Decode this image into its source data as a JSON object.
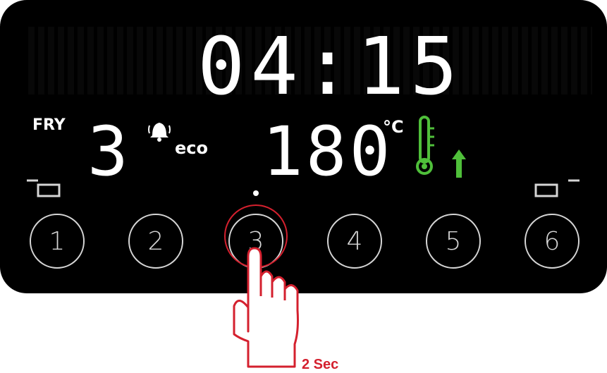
{
  "timer": {
    "value": "04:15"
  },
  "mode": {
    "label": "FRY",
    "level": "3",
    "eco_label": "eco"
  },
  "temperature": {
    "value": "180",
    "unit": "°C"
  },
  "buttons": [
    {
      "label": "1"
    },
    {
      "label": "2"
    },
    {
      "label": "3"
    },
    {
      "label": "4"
    },
    {
      "label": "5"
    },
    {
      "label": "6"
    }
  ],
  "hint": {
    "label": "2 Sec"
  },
  "colors": {
    "panel": "#000000",
    "display": "#ffffff",
    "accent_green": "#4fbf3a",
    "accent_red": "#d4202e",
    "button_outline": "#d5d5d5"
  },
  "icons": [
    "alarm-bell-icon",
    "thermometer-icon",
    "arrow-up-icon",
    "basket-left-icon",
    "basket-right-icon",
    "hand-pointer-icon"
  ]
}
